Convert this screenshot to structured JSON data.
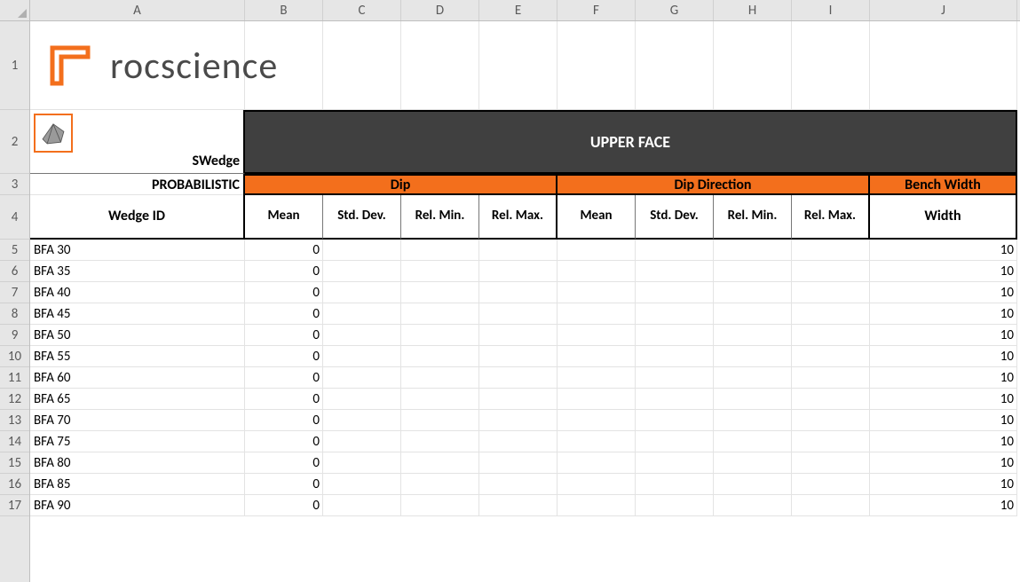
{
  "column_letters": [
    "A",
    "B",
    "C",
    "D",
    "E",
    "F",
    "G",
    "H",
    "I",
    "J"
  ],
  "row_numbers": [
    "1",
    "2",
    "3",
    "4",
    "5",
    "6",
    "7",
    "8",
    "9",
    "10",
    "11",
    "12",
    "13",
    "14",
    "15",
    "16",
    "17"
  ],
  "logo_text": "rocscience",
  "swedge_label": "SWedge",
  "upper_face": "UPPER FACE",
  "probabilistic": "PROBABILISTIC",
  "categories": {
    "dip": "Dip",
    "dip_direction": "Dip Direction",
    "bench_width": "Bench Width"
  },
  "headers": {
    "wedge_id": "Wedge ID",
    "mean": "Mean",
    "std_dev": "Std. Dev.",
    "rel_min": "Rel. Min.",
    "rel_max": "Rel. Max.",
    "width": "Width"
  },
  "rows": [
    {
      "wedge_id": "BFA 30",
      "dip_mean": "0",
      "bench_width": "10"
    },
    {
      "wedge_id": "BFA 35",
      "dip_mean": "0",
      "bench_width": "10"
    },
    {
      "wedge_id": "BFA 40",
      "dip_mean": "0",
      "bench_width": "10"
    },
    {
      "wedge_id": "BFA 45",
      "dip_mean": "0",
      "bench_width": "10"
    },
    {
      "wedge_id": "BFA 50",
      "dip_mean": "0",
      "bench_width": "10"
    },
    {
      "wedge_id": "BFA 55",
      "dip_mean": "0",
      "bench_width": "10"
    },
    {
      "wedge_id": "BFA 60",
      "dip_mean": "0",
      "bench_width": "10"
    },
    {
      "wedge_id": "BFA 65",
      "dip_mean": "0",
      "bench_width": "10"
    },
    {
      "wedge_id": "BFA 70",
      "dip_mean": "0",
      "bench_width": "10"
    },
    {
      "wedge_id": "BFA 75",
      "dip_mean": "0",
      "bench_width": "10"
    },
    {
      "wedge_id": "BFA 80",
      "dip_mean": "0",
      "bench_width": "10"
    },
    {
      "wedge_id": "BFA 85",
      "dip_mean": "0",
      "bench_width": "10"
    },
    {
      "wedge_id": "BFA 90",
      "dip_mean": "0",
      "bench_width": "10"
    }
  ]
}
